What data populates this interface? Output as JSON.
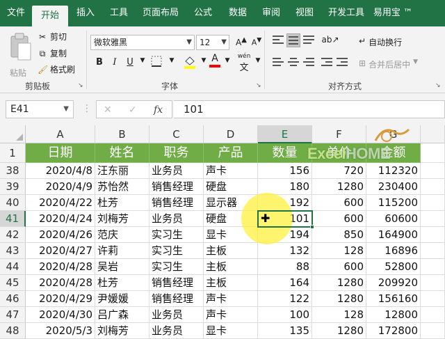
{
  "menu": {
    "tabs": [
      {
        "label": "文件",
        "active": false
      },
      {
        "label": "开始",
        "active": true
      },
      {
        "label": "插入",
        "active": false
      },
      {
        "label": "工具",
        "active": false
      },
      {
        "label": "页面布局",
        "active": false
      },
      {
        "label": "公式",
        "active": false
      },
      {
        "label": "数据",
        "active": false
      },
      {
        "label": "审阅",
        "active": false
      },
      {
        "label": "视图",
        "active": false
      },
      {
        "label": "开发工具",
        "active": false
      },
      {
        "label": "易用宝 ™",
        "active": false
      }
    ]
  },
  "ribbon": {
    "clipboard": {
      "paste_label": "粘贴",
      "cut_label": "剪切",
      "copy_label": "复制",
      "format_painter_label": "格式刷",
      "group_label": "剪贴板"
    },
    "font": {
      "font_name": "微软雅黑",
      "font_size": "12",
      "bold": "B",
      "italic": "I",
      "underline": "U",
      "font_color_letter": "A",
      "phonetic": "wén",
      "group_label": "字体",
      "fill_color": "#ffff00",
      "text_color": "#ff0000"
    },
    "alignment": {
      "wrap_text_label": "自动换行",
      "merge_center_label": "合并后居中",
      "group_label": "对齐方式"
    }
  },
  "formula_bar": {
    "name_box": "E41",
    "fx_label": "fx",
    "cancel_icon": "✕",
    "confirm_icon": "✓",
    "value": "101"
  },
  "grid": {
    "columns": [
      "A",
      "B",
      "C",
      "D",
      "E",
      "F",
      "G"
    ],
    "selected_column": "E",
    "header_row": {
      "row_number": "1",
      "cells": [
        "日期",
        "姓名",
        "职务",
        "产品",
        "数量",
        "单价",
        "金额"
      ]
    },
    "rows": [
      {
        "n": "38",
        "cells": [
          "2020/4/8",
          "汪东丽",
          "业务员",
          "声卡",
          "156",
          "720",
          "112320"
        ]
      },
      {
        "n": "39",
        "cells": [
          "2020/4/9",
          "苏怡然",
          "销售经理",
          "硬盘",
          "180",
          "1280",
          "230400"
        ]
      },
      {
        "n": "40",
        "cells": [
          "2020/4/22",
          "杜芳",
          "销售经理",
          "显示器",
          "192",
          "600",
          "115200"
        ]
      },
      {
        "n": "41",
        "cells": [
          "2020/4/24",
          "刘梅芳",
          "业务员",
          "硬盘",
          "101",
          "600",
          "60600"
        ]
      },
      {
        "n": "42",
        "cells": [
          "2020/4/26",
          "范庆",
          "实习生",
          "显卡",
          "194",
          "850",
          "164900"
        ]
      },
      {
        "n": "43",
        "cells": [
          "2020/4/27",
          "许莉",
          "实习生",
          "主板",
          "132",
          "128",
          "16896"
        ]
      },
      {
        "n": "44",
        "cells": [
          "2020/4/28",
          "吴岩",
          "实习生",
          "主板",
          "88",
          "600",
          "52800"
        ]
      },
      {
        "n": "45",
        "cells": [
          "2020/4/28",
          "杜芳",
          "销售经理",
          "主板",
          "164",
          "1280",
          "209920"
        ]
      },
      {
        "n": "46",
        "cells": [
          "2020/4/29",
          "尹媛媛",
          "销售经理",
          "声卡",
          "122",
          "1280",
          "156160"
        ]
      },
      {
        "n": "47",
        "cells": [
          "2020/4/30",
          "吕广森",
          "业务员",
          "声卡",
          "100",
          "128",
          "12800"
        ]
      },
      {
        "n": "48",
        "cells": [
          "2020/5/3",
          "刘梅芳",
          "业务员",
          "显卡",
          "135",
          "1280",
          "172800"
        ]
      }
    ],
    "active_cell": "E41"
  },
  "watermark": {
    "text_a": "Excel",
    "text_b": "HOME"
  },
  "colors": {
    "brand": "#217346",
    "header_fill": "#70ad47"
  }
}
